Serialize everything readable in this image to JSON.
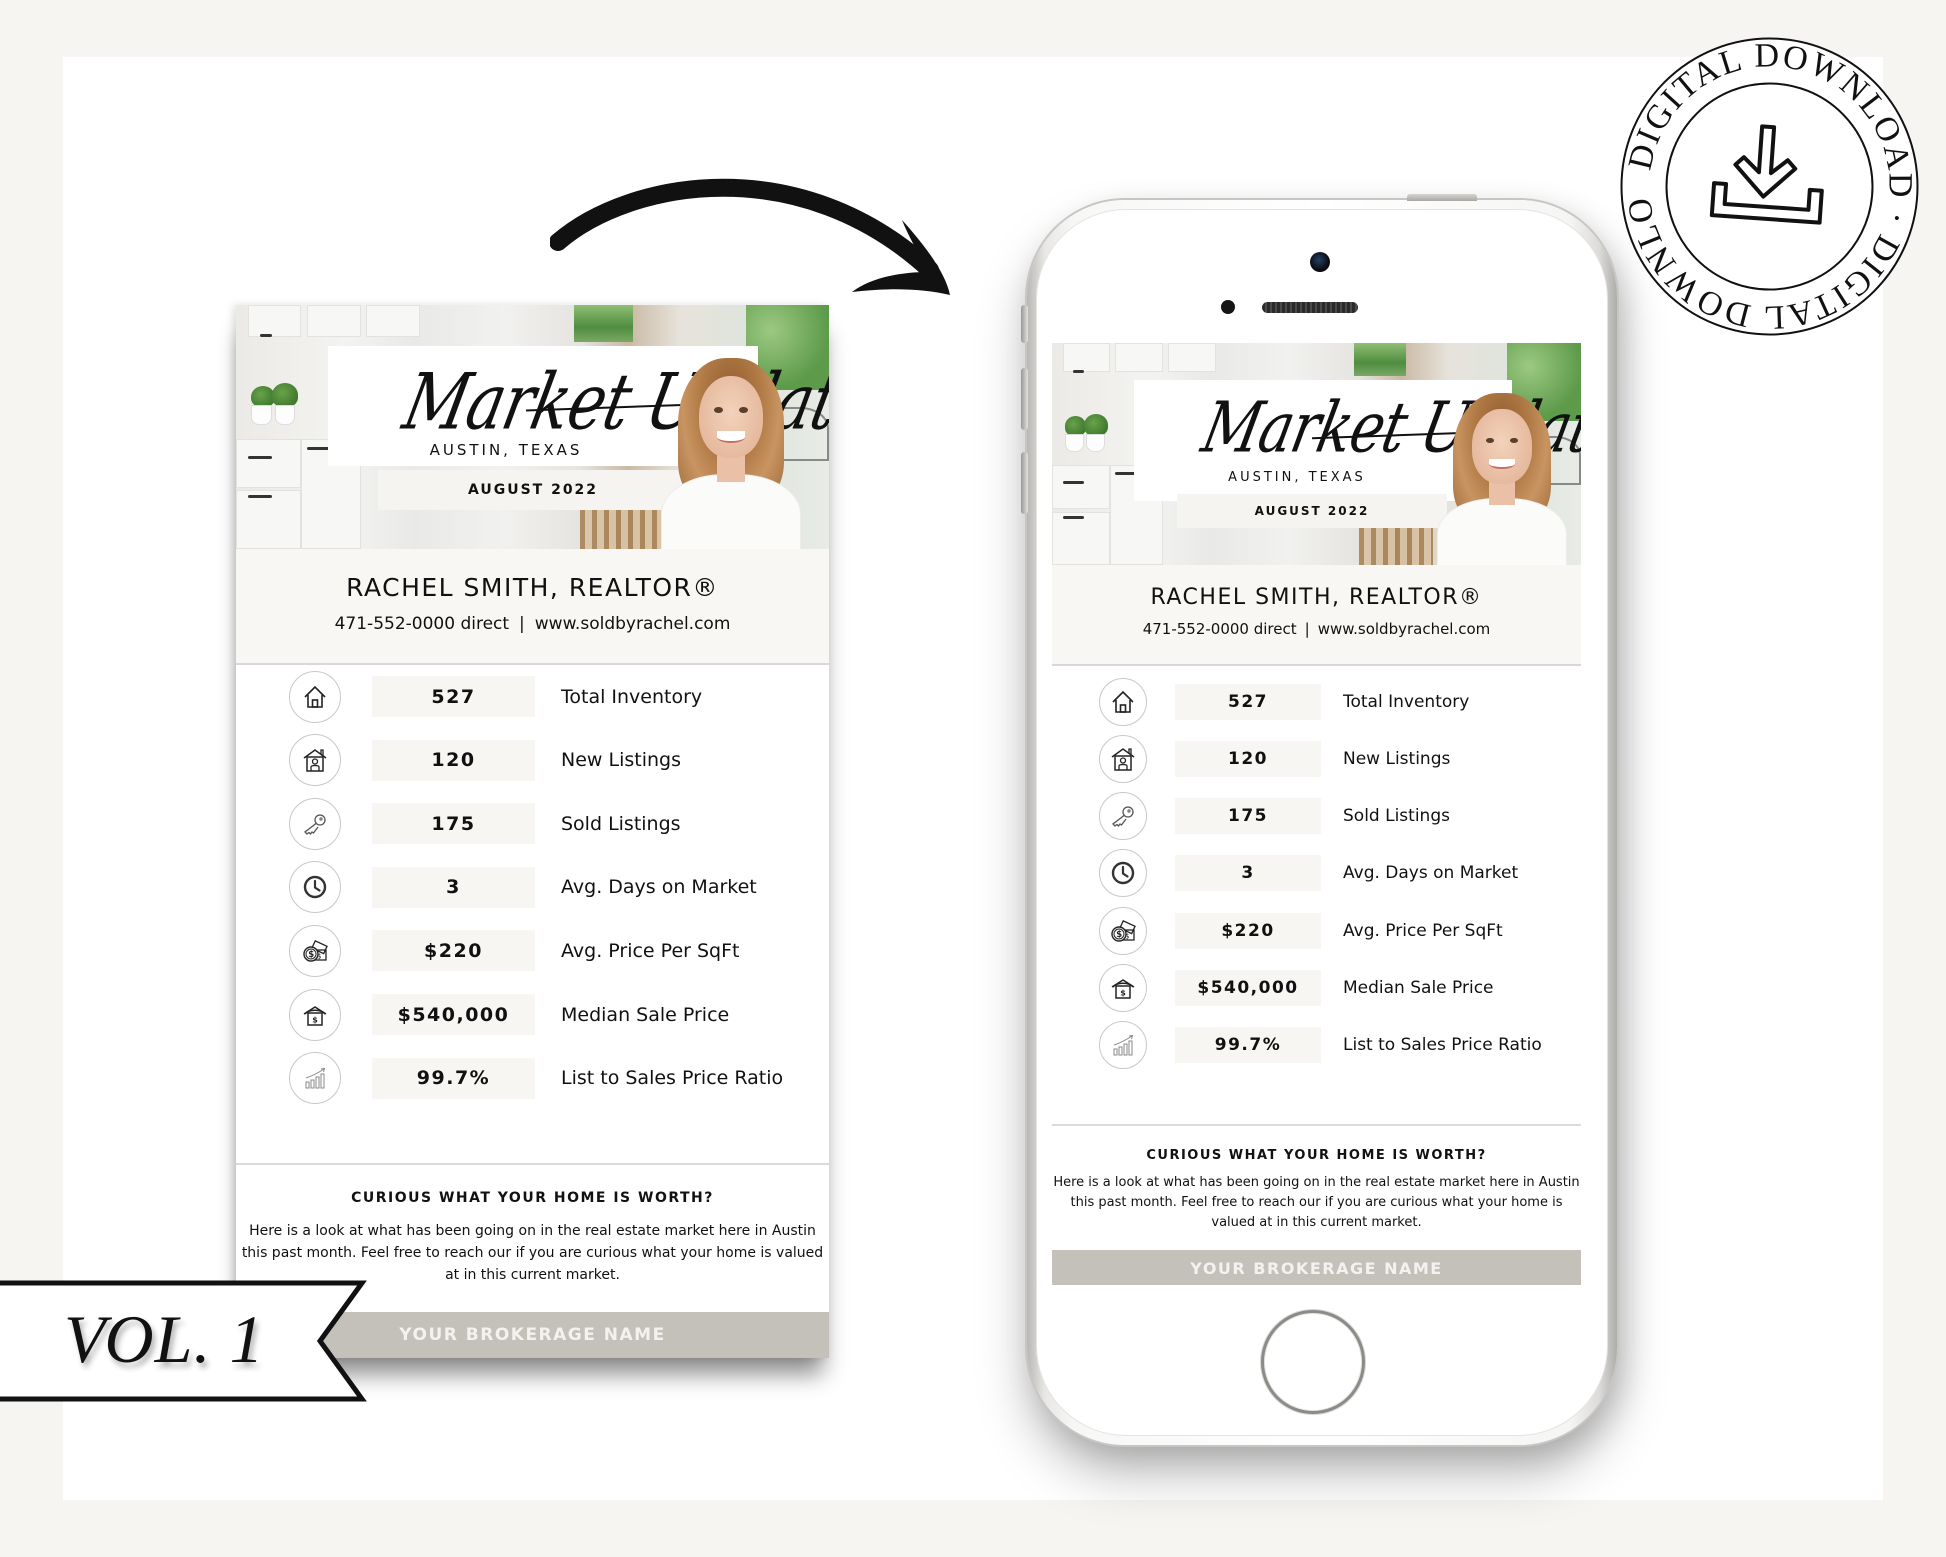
{
  "flyer": {
    "title_script": "Market Update",
    "city": "AUSTIN, TEXAS",
    "date": "AUGUST 2022",
    "agent_name": "RACHEL SMITH, REALTOR®",
    "phone": "471-552-0000 direct",
    "separator": "|",
    "website": "www.soldbyrachel.com",
    "metrics": [
      {
        "icon": "house-icon",
        "value": "527",
        "label": "Total Inventory"
      },
      {
        "icon": "house-person-icon",
        "value": "120",
        "label": "New Listings"
      },
      {
        "icon": "key-icon",
        "value": "175",
        "label": "Sold Listings"
      },
      {
        "icon": "clock-icon",
        "value": "3",
        "label": "Avg. Days on Market"
      },
      {
        "icon": "money-icon",
        "value": "$220",
        "label": "Avg. Price Per SqFt"
      },
      {
        "icon": "house-dollar-icon",
        "value": "$540,000",
        "label": "Median Sale Price"
      },
      {
        "icon": "growth-chart-icon",
        "value": "99.7%",
        "label": "List to Sales Price Ratio"
      }
    ],
    "cta_title": "CURIOUS WHAT YOUR HOME IS WORTH?",
    "cta_body": "Here is a look at what has been going on in the real estate market here in Austin this past month. Feel free to reach our if you are curious what your home is valued at in this current market.",
    "brokerage": "YOUR BROKERAGE NAME"
  },
  "badge": {
    "ring_text": "DIGITAL DOWNLOAD · DIGITAL DOWNLOAD ·",
    "icon": "download-icon"
  },
  "ribbon": {
    "text": "VOL. 1"
  },
  "colors": {
    "background": "#f6f5f1",
    "panel": "#ffffff",
    "value_box": "#f7f6f3",
    "brokerage_bar": "#c4c1ba",
    "text": "#111111"
  }
}
